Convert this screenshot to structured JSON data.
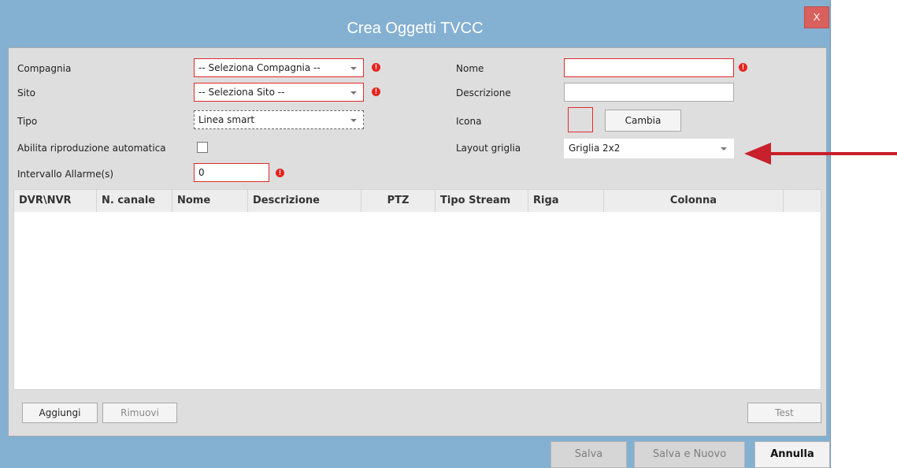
{
  "dialog": {
    "title": "Crea Oggetti TVCC",
    "close_label": "X"
  },
  "form": {
    "company": {
      "label": "Compagnia",
      "value": "-- Seleziona Compagnia --"
    },
    "site": {
      "label": "Sito",
      "value": "-- Seleziona Sito --"
    },
    "type": {
      "label": "Tipo",
      "value": "Linea smart"
    },
    "autoplay": {
      "label": "Abilita riproduzione automatica",
      "checked": false
    },
    "alarm_interval": {
      "label": "Intervallo Allarme(s)",
      "value": "0"
    },
    "name": {
      "label": "Nome",
      "value": ""
    },
    "description": {
      "label": "Descrizione",
      "value": ""
    },
    "icon": {
      "label": "Icona",
      "change_button": "Cambia"
    },
    "grid_layout": {
      "label": "Layout griglia",
      "value": "Griglia 2x2"
    }
  },
  "table": {
    "columns": [
      "DVR\\NVR",
      "N. canale",
      "Nome",
      "Descrizione",
      "PTZ",
      "Tipo Stream",
      "Riga",
      "Colonna"
    ],
    "rows": []
  },
  "table_actions": {
    "add": "Aggiungi",
    "remove": "Rimuovi",
    "test": "Test"
  },
  "footer": {
    "save": "Salva",
    "save_new": "Salva e Nuovo",
    "cancel": "Annulla"
  },
  "icons": {
    "error": "!",
    "arrow": "red-arrow-pointing-left"
  },
  "colors": {
    "titlebar": "#84b0d2",
    "error": "#e02b2b",
    "arrow": "#c8202c",
    "close": "#d9605c"
  }
}
